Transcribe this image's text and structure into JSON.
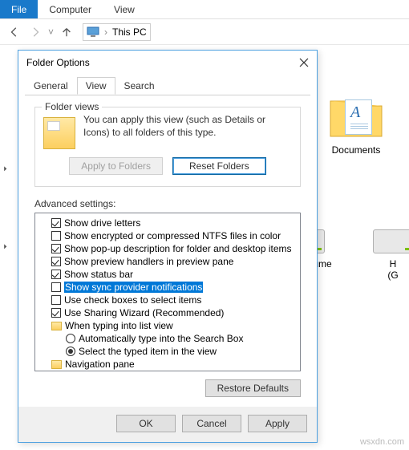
{
  "ribbon": {
    "file": "File",
    "computer": "Computer",
    "view": "View"
  },
  "address": {
    "location": "This PC"
  },
  "bg": {
    "documents": "Documents",
    "drive1": "New Volume (F:)",
    "drive2_a": "H",
    "drive2_b": "(G"
  },
  "dialog": {
    "title": "Folder Options",
    "tabs": {
      "general": "General",
      "view": "View",
      "search": "Search"
    },
    "folder_views": {
      "legend": "Folder views",
      "text": "You can apply this view (such as Details or Icons) to all folders of this type.",
      "apply": "Apply to Folders",
      "reset": "Reset Folders"
    },
    "advanced_label": "Advanced settings:",
    "items": [
      {
        "kind": "chk",
        "on": true,
        "label": "Show drive letters"
      },
      {
        "kind": "chk",
        "on": false,
        "label": "Show encrypted or compressed NTFS files in color"
      },
      {
        "kind": "chk",
        "on": true,
        "label": "Show pop-up description for folder and desktop items"
      },
      {
        "kind": "chk",
        "on": true,
        "label": "Show preview handlers in preview pane"
      },
      {
        "kind": "chk",
        "on": true,
        "label": "Show status bar"
      },
      {
        "kind": "chk",
        "on": false,
        "label": "Show sync provider notifications",
        "selected": true
      },
      {
        "kind": "chk",
        "on": false,
        "label": "Use check boxes to select items"
      },
      {
        "kind": "chk",
        "on": true,
        "label": "Use Sharing Wizard (Recommended)"
      },
      {
        "kind": "folder",
        "label": "When typing into list view"
      },
      {
        "kind": "radio",
        "on": false,
        "sub": true,
        "label": "Automatically type into the Search Box"
      },
      {
        "kind": "radio",
        "on": true,
        "sub": true,
        "label": "Select the typed item in the view"
      },
      {
        "kind": "folder",
        "label": "Navigation pane"
      }
    ],
    "restore": "Restore Defaults",
    "buttons": {
      "ok": "OK",
      "cancel": "Cancel",
      "apply": "Apply"
    }
  },
  "watermark": "wsxdn.com"
}
